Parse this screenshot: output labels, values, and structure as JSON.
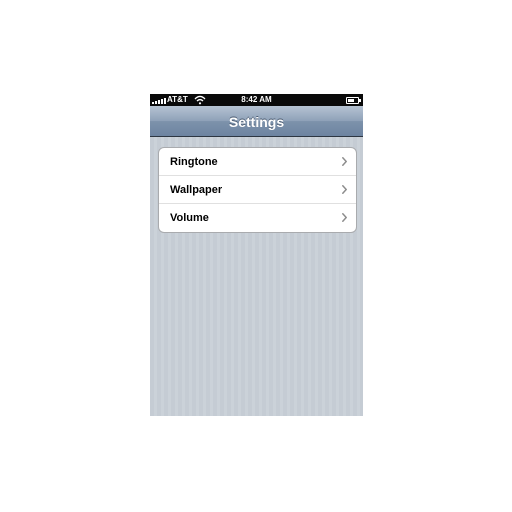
{
  "status_bar": {
    "carrier": "AT&T",
    "time": "8:42 AM",
    "signal_icon": "signal-bars-icon",
    "wifi_icon": "wifi-icon",
    "battery_icon": "battery-icon",
    "battery_level": 0.7
  },
  "nav_bar": {
    "title": "Settings"
  },
  "settings_list": {
    "items": [
      {
        "label": "Ringtone",
        "icon": "chevron-right-icon"
      },
      {
        "label": "Wallpaper",
        "icon": "chevron-right-icon"
      },
      {
        "label": "Volume",
        "icon": "chevron-right-icon"
      }
    ]
  },
  "colors": {
    "status_bar_bg": "#0a0a0a",
    "nav_bar_top": "#b6c3d3",
    "nav_bar_bottom": "#6d84a1",
    "background_stripe": "#c5ccd4",
    "chevron": "#8c8c8c"
  }
}
